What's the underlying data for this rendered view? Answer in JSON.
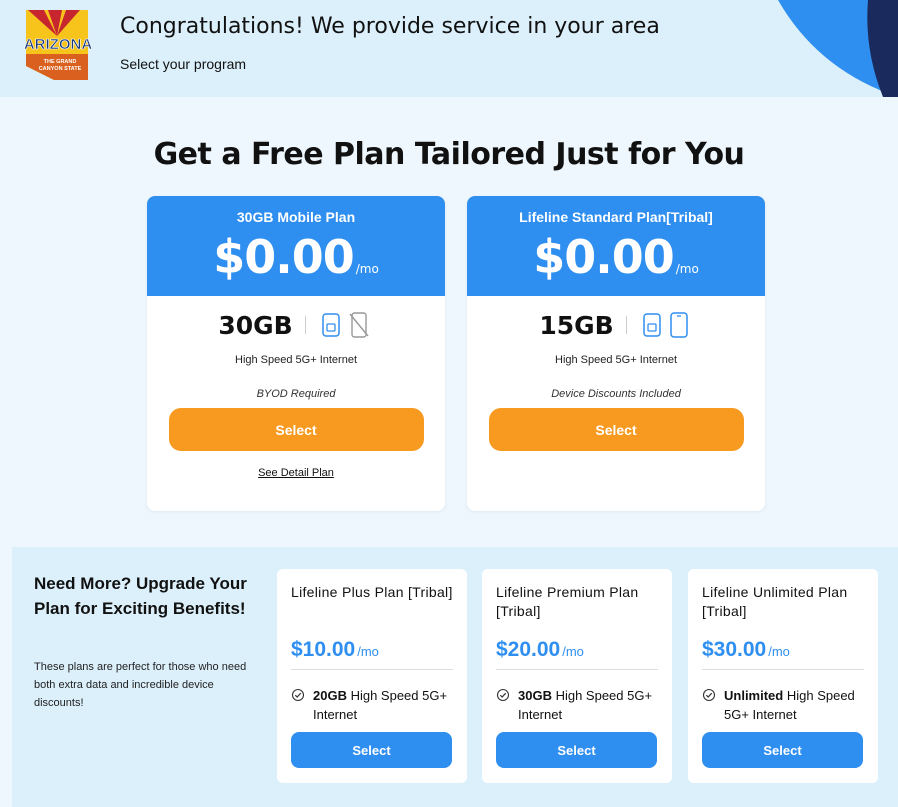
{
  "header": {
    "logo": {
      "state": "ARIZONA",
      "tagline": "THE GRAND CANYON STATE"
    },
    "title": "Congratulations! We provide service in your area",
    "subtitle": "Select your program"
  },
  "main_title": "Get a Free Plan Tailored Just for You",
  "plans": [
    {
      "name": "30GB Mobile Plan",
      "price": "$0.00",
      "per": "/mo",
      "data": "30GB",
      "icons": [
        "sim-card-icon",
        "no-phone-icon"
      ],
      "speed": "High Speed 5G+ Internet",
      "note": "BYOD Required",
      "select_label": "Select",
      "detail_link": "See Detail Plan"
    },
    {
      "name": "Lifeline Standard Plan[Tribal]",
      "price": "$0.00",
      "per": "/mo",
      "data": "15GB",
      "icons": [
        "sim-card-icon",
        "phone-icon"
      ],
      "speed": "High Speed 5G+ Internet",
      "note": "Device Discounts Included",
      "select_label": "Select"
    }
  ],
  "upgrade": {
    "title": "Need More? Upgrade Your Plan for Exciting Benefits!",
    "text": "These plans are perfect for those who need both extra data and incredible device discounts!",
    "plans": [
      {
        "name": "Lifeline Plus Plan [Tribal]",
        "price": "$10.00",
        "per": "/mo",
        "feature_bold": "20GB",
        "feature_rest": " High Speed 5G+ Internet",
        "select_label": "Select"
      },
      {
        "name": "Lifeline Premium Plan [Tribal]",
        "price": "$20.00",
        "per": "/mo",
        "feature_bold": "30GB",
        "feature_rest": " High Speed 5G+ Internet",
        "select_label": "Select"
      },
      {
        "name": "Lifeline Unlimited Plan [Tribal]",
        "price": "$30.00",
        "per": "/mo",
        "feature_bold": "Unlimited",
        "feature_rest": " High Speed 5G+ Internet",
        "select_label": "Select"
      }
    ]
  },
  "colors": {
    "primary_blue": "#2f8ff0",
    "accent_orange": "#f79a1f",
    "bg_light": "#dcf0fb",
    "navy": "#1a2a5c"
  }
}
